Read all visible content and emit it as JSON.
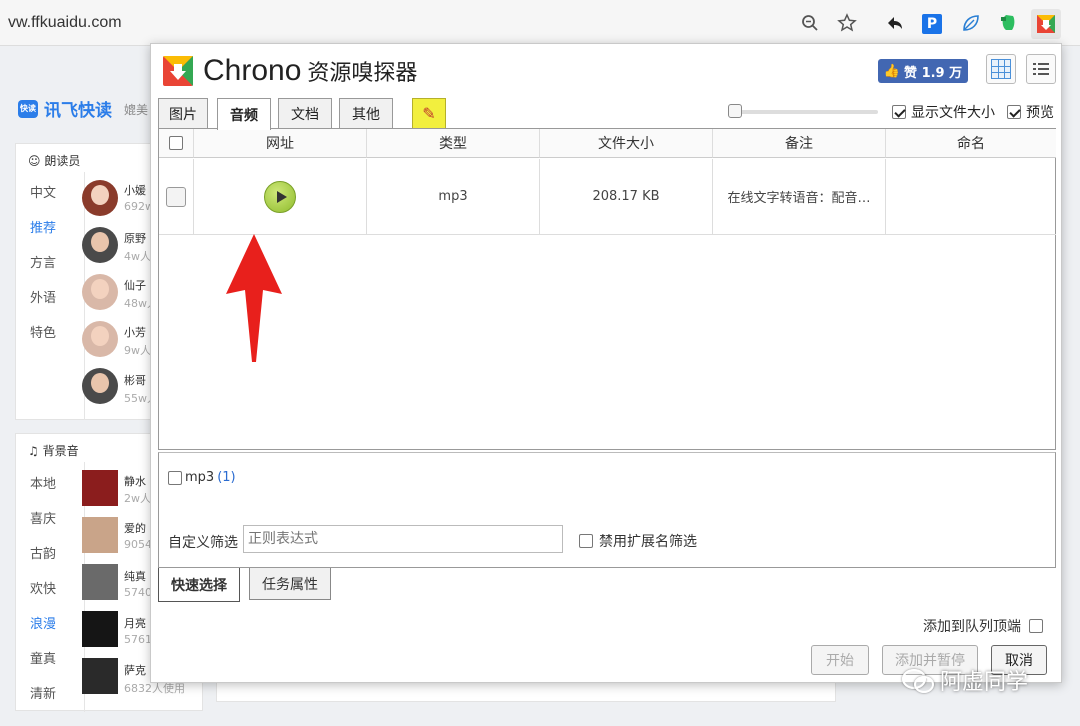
{
  "browser": {
    "url": "vw.ffkuaidu.com",
    "icons": [
      "zoom-icon",
      "star-icon",
      "undo-ext-icon",
      "p-ext-icon",
      "leaf-ext-icon",
      "evernote-icon",
      "chrono-ext-icon"
    ],
    "p_ext_letter": "P"
  },
  "background": {
    "brand": "讯飞快读",
    "brand_logo_text": "快读",
    "brand_sub": "媲美",
    "readers": {
      "title": "朗读员",
      "categories": [
        "中文",
        "推荐",
        "方言",
        "外语",
        "特色"
      ],
      "active_category": "推荐",
      "items": [
        {
          "name": "小媛",
          "sub": "692w"
        },
        {
          "name": "原野",
          "sub": "4w人"
        },
        {
          "name": "仙子",
          "sub": "48w人"
        },
        {
          "name": "小芳",
          "sub": "9w人"
        },
        {
          "name": "彬哥",
          "sub": "55w人"
        }
      ]
    },
    "music": {
      "title": "背景音",
      "categories": [
        "本地",
        "喜庆",
        "古韵",
        "欢快",
        "浪漫",
        "童真",
        "清新"
      ],
      "active_category": "浪漫",
      "items": [
        {
          "name": "静水",
          "sub": "2w人"
        },
        {
          "name": "爱的",
          "sub": "9054"
        },
        {
          "name": "纯真",
          "sub": "5740"
        },
        {
          "name": "月亮",
          "sub": "5761"
        },
        {
          "name": "萨克",
          "sub": "6832人使用"
        }
      ]
    }
  },
  "chrono": {
    "title_main": "Chrono",
    "title_sub": "资源嗅探器",
    "like_label": "赞 1.9 万",
    "tabs": [
      "图片",
      "音频",
      "文档",
      "其他"
    ],
    "active_tab": "音频",
    "show_size_label": "显示文件大小",
    "preview_label": "预览",
    "columns": [
      "网址",
      "类型",
      "文件大小",
      "备注",
      "命名"
    ],
    "rows": [
      {
        "type": "mp3",
        "size": "208.17 KB",
        "note": "在线文字转语音：配音…",
        "name": ""
      }
    ],
    "filter_ext": "mp3",
    "filter_count": "(1)",
    "custom_filter_label": "自定义筛选",
    "regex_placeholder": "正则表达式",
    "disable_ext_label": "禁用扩展名筛选",
    "bottom_tabs": [
      "快速选择",
      "任务属性"
    ],
    "queue_top_label": "添加到队列顶端",
    "buttons": {
      "start": "开始",
      "add_pause": "添加并暂停",
      "cancel": "取消"
    }
  },
  "watermark": "阿虚同学",
  "colors": {
    "accent": "#2b7de9",
    "like": "#4267b2",
    "arrow": "#e8201c"
  }
}
